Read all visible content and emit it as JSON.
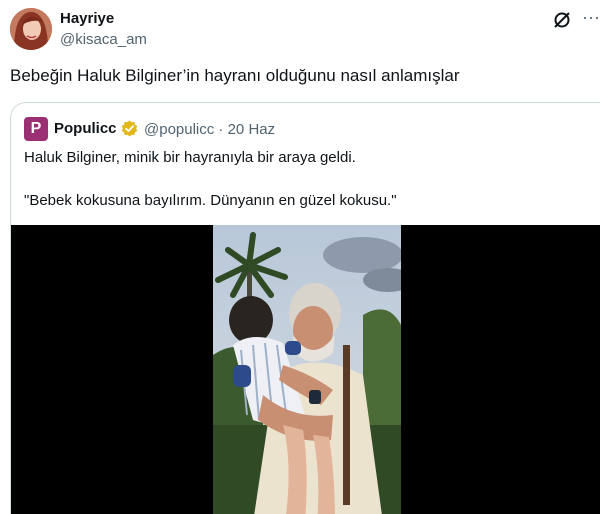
{
  "author": {
    "display_name": "Hayriye",
    "handle": "@kisaca_am"
  },
  "tweet": {
    "text": "Bebeğin Haluk Bilginer’in hayranı olduğunu nasıl anlamışlar"
  },
  "header_icons": {
    "grok": "grok-icon",
    "more": "more-icon",
    "more_glyph": "···"
  },
  "quote": {
    "avatar_letter": "P",
    "display_name": "Populicc",
    "badge": "verified-gold-icon",
    "handle_date": "@populicc · 20 Haz",
    "line1": "Haluk Bilginer, minik bir hayranıyla bir araya geldi.",
    "line2": "\"Bebek kokusuna bayılırım. Dünyanın en güzel kokusu.\""
  },
  "colors": {
    "text": "#0f1419",
    "secondary": "#536471",
    "border": "#cfd9de",
    "brand": "#9b2f74",
    "badge": "#e2b719"
  }
}
